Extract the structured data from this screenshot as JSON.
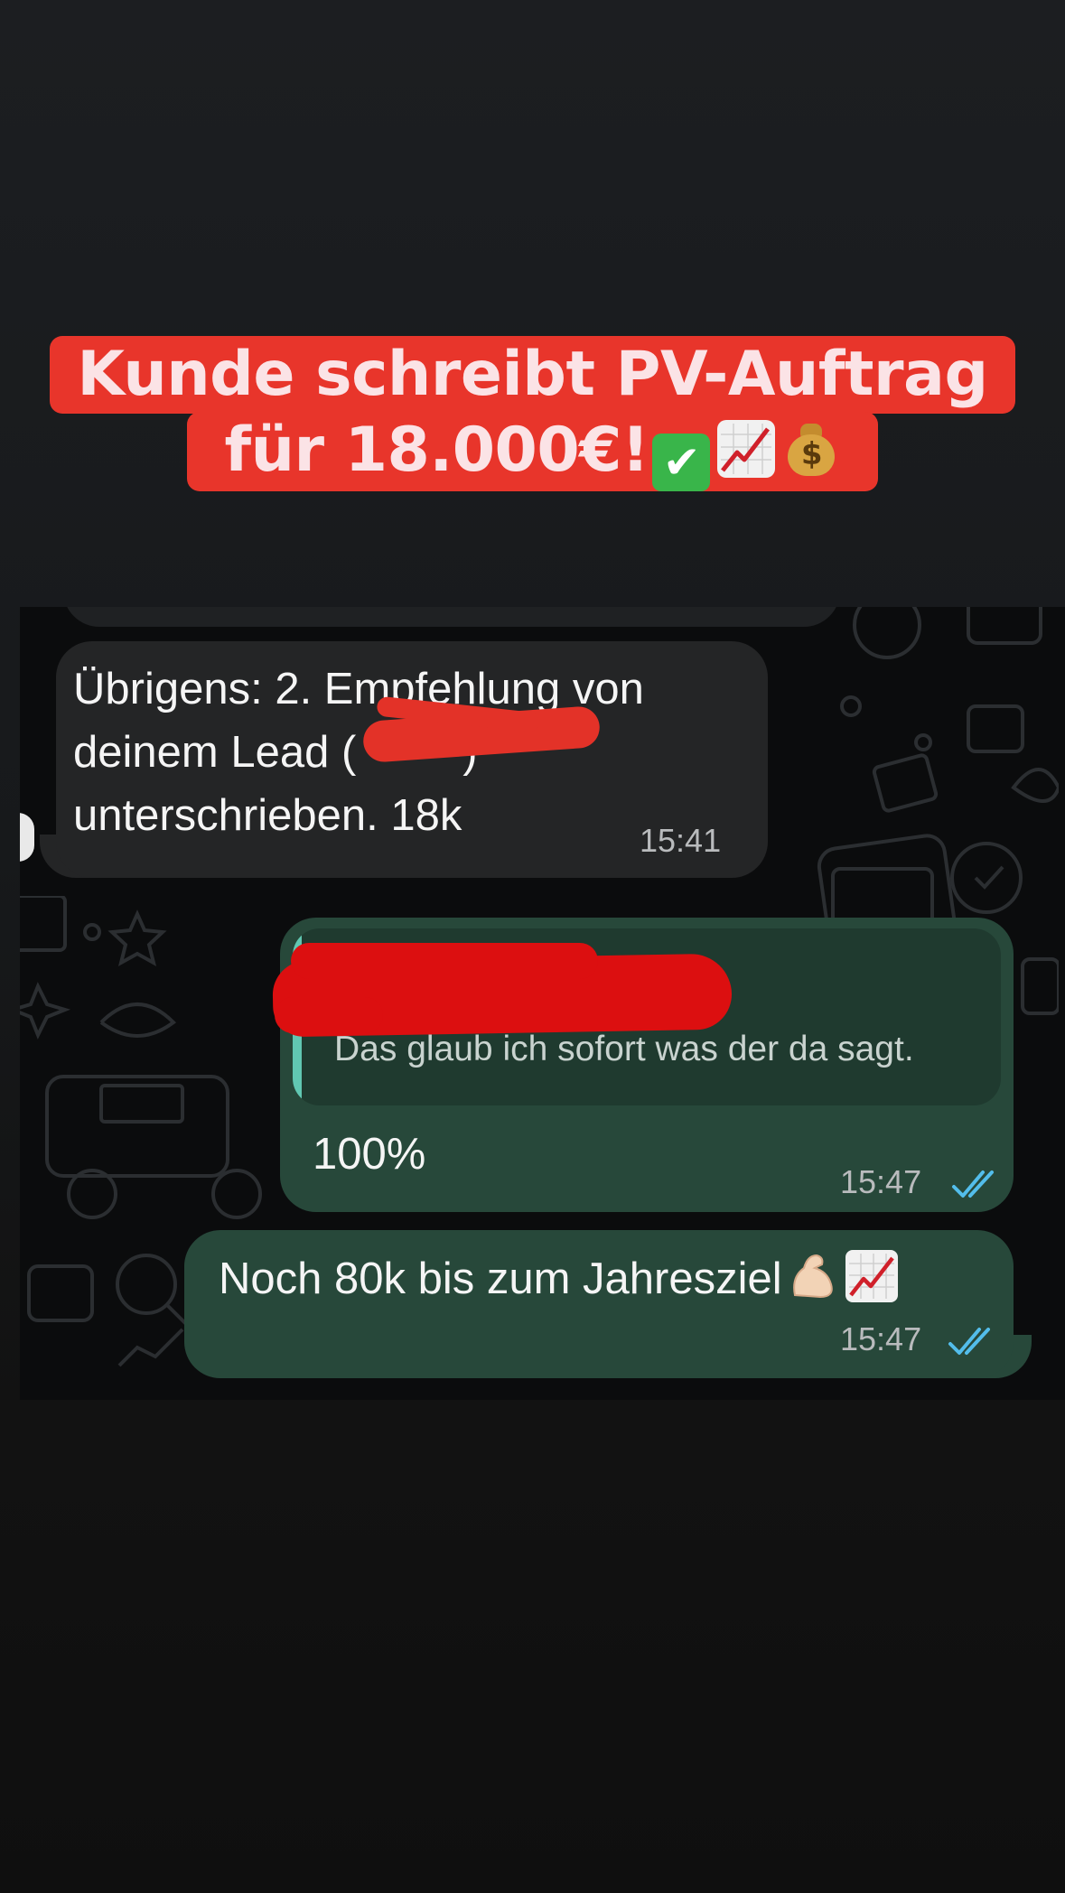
{
  "caption": {
    "line1": "Kunde schreibt PV-Auftrag",
    "line2": "für 18.000€!",
    "emoji": [
      "check-mark-button",
      "chart-increasing",
      "money-bag"
    ]
  },
  "chat": {
    "messages": [
      {
        "direction": "incoming",
        "text_line1": "Übrigens: 2. Empfehlung von",
        "text_line2": "deinem Lead (",
        "text_line2_end": ")",
        "text_line3": "unterschrieben. 18k",
        "time": "15:41"
      },
      {
        "direction": "outgoing",
        "quoted_text": "Das glaub ich sofort was der da sagt.",
        "text": "100%",
        "time": "15:47",
        "status": "read"
      },
      {
        "direction": "outgoing",
        "text": "Noch 80k bis zum Jahresziel",
        "emoji": [
          "flexed-biceps",
          "chart-increasing"
        ],
        "time": "15:47",
        "status": "read"
      }
    ]
  },
  "colors": {
    "caption_bg": "#e8352b",
    "caption_text": "#fbe3e6",
    "incoming_bubble": "#242526",
    "outgoing_bubble": "#27483a",
    "quote_bg": "#1f3a2f",
    "quote_bar": "#61c7b2",
    "read_ticks": "#53bdeb",
    "redaction": "#dc0f10"
  }
}
